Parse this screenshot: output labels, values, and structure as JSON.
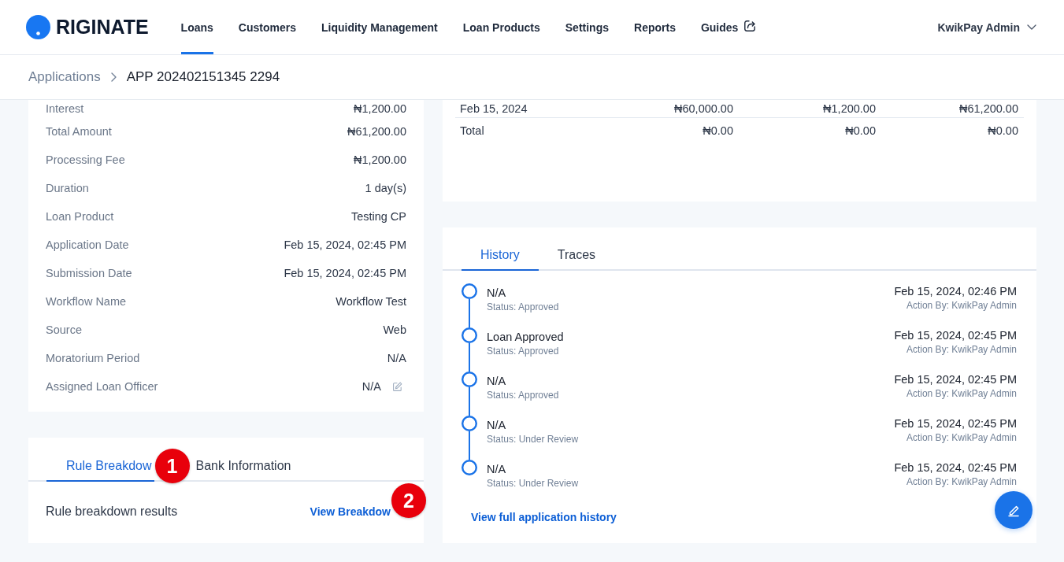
{
  "header": {
    "logo_text": "RIGINATE",
    "nav": [
      {
        "label": "Loans",
        "selected": true,
        "external": false
      },
      {
        "label": "Customers",
        "selected": false,
        "external": false
      },
      {
        "label": "Liquidity Management",
        "selected": false,
        "external": false
      },
      {
        "label": "Loan Products",
        "selected": false,
        "external": false
      },
      {
        "label": "Settings",
        "selected": false,
        "external": false
      },
      {
        "label": "Reports",
        "selected": false,
        "external": false
      },
      {
        "label": "Guides",
        "selected": false,
        "external": true
      }
    ],
    "user_menu": "KwikPay Admin"
  },
  "breadcrumb": {
    "parent": "Applications",
    "current": "APP 202402151345 2294"
  },
  "loan_details": {
    "rows": [
      {
        "label": "Interest",
        "value": "₦1,200.00",
        "editable": false
      },
      {
        "label": "Total Amount",
        "value": "₦61,200.00",
        "editable": false
      },
      {
        "label": "Processing Fee",
        "value": "₦1,200.00",
        "editable": false
      },
      {
        "label": "Duration",
        "value": "1 day(s)",
        "editable": false
      },
      {
        "label": "Loan Product",
        "value": "Testing CP",
        "editable": false
      },
      {
        "label": "Application Date",
        "value": "Feb 15, 2024, 02:45 PM",
        "editable": false
      },
      {
        "label": "Submission Date",
        "value": "Feb 15, 2024, 02:45 PM",
        "editable": false
      },
      {
        "label": "Workflow Name",
        "value": "Workflow Test",
        "editable": false
      },
      {
        "label": "Source",
        "value": "Web",
        "editable": false
      },
      {
        "label": "Moratorium Period",
        "value": "N/A",
        "editable": false
      },
      {
        "label": "Assigned Loan Officer",
        "value": "N/A",
        "editable": true
      }
    ]
  },
  "schedule_table": {
    "rows": [
      [
        "Feb 15, 2024",
        "₦60,000.00",
        "₦1,200.00",
        "₦61,200.00"
      ],
      [
        "Total",
        "₦0.00",
        "₦0.00",
        "₦0.00"
      ]
    ]
  },
  "rule_card": {
    "tabs": [
      {
        "label": "Rule Breakdow",
        "selected": true,
        "marker": "1"
      },
      {
        "label": "Bank Information",
        "selected": false
      }
    ],
    "text": "Rule breakdown results",
    "link": {
      "label": "View Breakdow",
      "marker": "2"
    }
  },
  "history_card": {
    "tabs": [
      {
        "label": "History",
        "selected": true
      },
      {
        "label": "Traces",
        "selected": false
      }
    ],
    "events": [
      {
        "title": "N/A",
        "status": "Status: Approved",
        "date": "Feb 15, 2024, 02:46 PM",
        "action_by": "Action By: KwikPay Admin"
      },
      {
        "title": "Loan Approved",
        "status": "Status: Approved",
        "date": "Feb 15, 2024, 02:45 PM",
        "action_by": "Action By: KwikPay Admin"
      },
      {
        "title": "N/A",
        "status": "Status: Approved",
        "date": "Feb 15, 2024, 02:45 PM",
        "action_by": "Action By: KwikPay Admin"
      },
      {
        "title": "N/A",
        "status": "Status: Under Review",
        "date": "Feb 15, 2024, 02:45 PM",
        "action_by": "Action By: KwikPay Admin"
      },
      {
        "title": "N/A",
        "status": "Status: Under Review",
        "date": "Feb 15, 2024, 02:45 PM",
        "action_by": "Action By: KwikPay Admin"
      }
    ],
    "footer_link": "View full application history"
  }
}
